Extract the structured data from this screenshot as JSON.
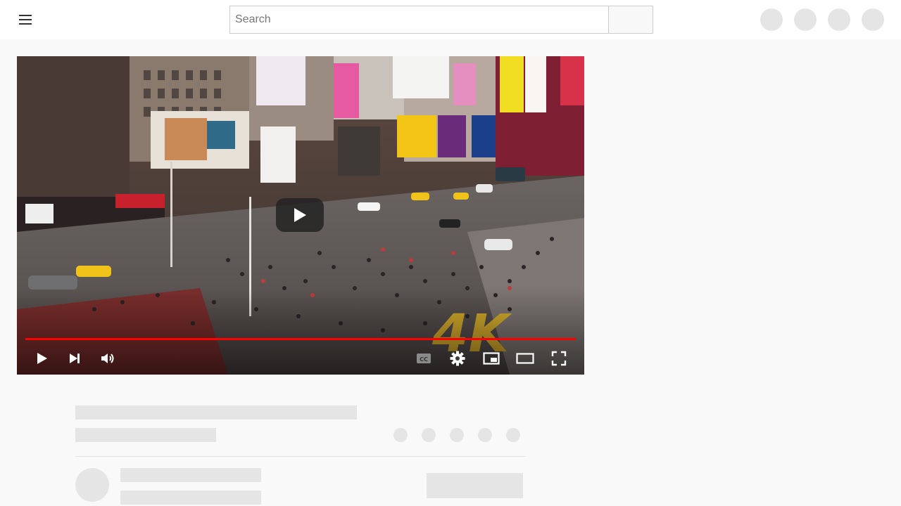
{
  "header": {
    "search": {
      "placeholder": "Search",
      "value": ""
    },
    "icons": [
      "menu-icon",
      "search-icon",
      "create-icon",
      "apps-icon",
      "notifications-icon",
      "avatar"
    ]
  },
  "player": {
    "progress_fraction": 1.0,
    "overlay_text": "4K",
    "controls": [
      "play-icon",
      "next-icon",
      "volume-icon",
      "captions-icon",
      "settings-icon",
      "miniplayer-icon",
      "theater-mode-icon",
      "fullscreen-icon"
    ],
    "colors": {
      "progress": "#ff0000",
      "controls": "#ffffff",
      "overlay_4k": "#e2b52a"
    }
  },
  "colors": {
    "page_background": "#f9f9f9",
    "skeleton": "#e5e5e5"
  }
}
